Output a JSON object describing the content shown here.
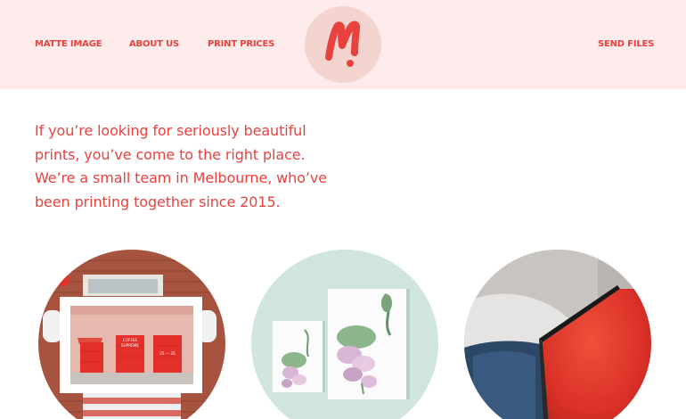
{
  "header": {
    "nav": {
      "home": "MATTE IMAGE",
      "about": "ABOUT US",
      "prices": "PRINT PRICES",
      "send": "SEND FILES"
    },
    "logo_letter": "M"
  },
  "intro": {
    "text": "If you’re looking for seriously beautiful prints, you’ve come to the right place. We’re a small team in Melbourne, who’ve been printing together since 2015."
  },
  "gallery": {
    "photo1": {
      "sign_line1": "COFFEE",
      "sign_line2": "SUPREME",
      "numbers": "25 — 35"
    }
  },
  "colors": {
    "accent": "#e8423f",
    "header_bg": "#fdeceb",
    "logo_bg": "#f3d4cf",
    "mint": "#cfe5dd"
  }
}
